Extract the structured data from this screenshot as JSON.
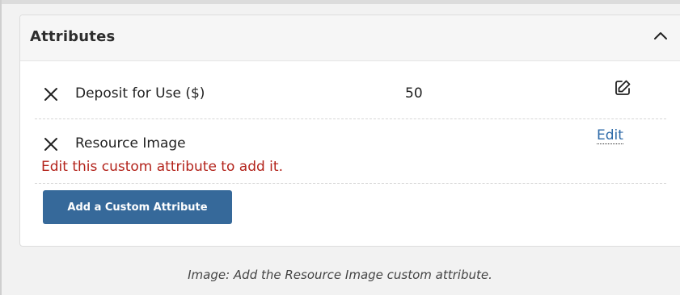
{
  "panel": {
    "title": "Attributes",
    "collapse_icon": "chevron-up-icon"
  },
  "attributes": [
    {
      "label": "Deposit for Use ($)",
      "value": "50",
      "remove_icon": "close-icon",
      "action_icon": "edit-icon"
    },
    {
      "label": "Resource Image",
      "value": "",
      "remove_icon": "close-icon",
      "action_label": "Edit",
      "error": "Edit this custom attribute to add it."
    }
  ],
  "add_button_label": "Add a Custom Attribute",
  "caption": "Image: Add the Resource Image custom attribute.",
  "colors": {
    "button": "#36699a",
    "link": "#2d6aa8",
    "error": "#b3231b"
  }
}
